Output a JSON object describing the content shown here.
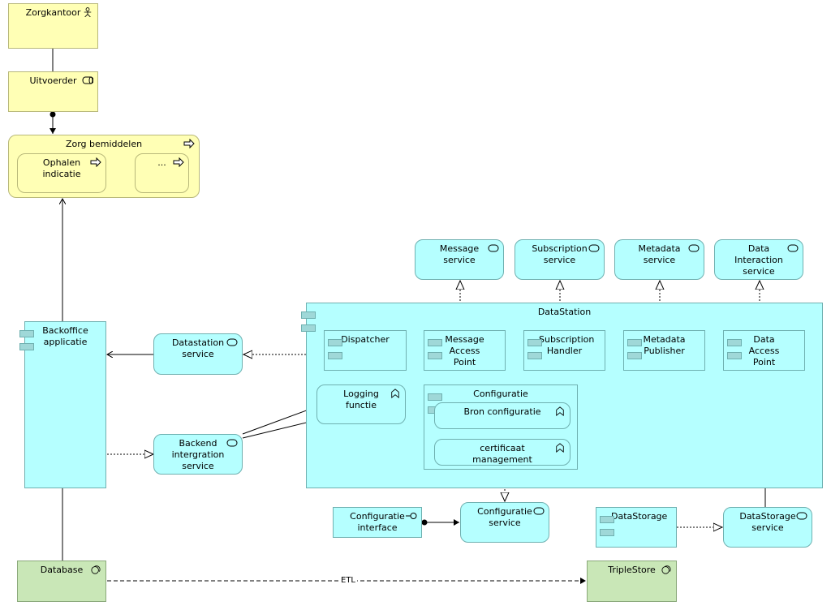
{
  "colors": {
    "business": "#ffffb5",
    "application": "#b5ffff",
    "technology": "#c9e7b7"
  },
  "elements": {
    "zorgkantoor": {
      "label": "Zorgkantoor",
      "icon": "actor-icon"
    },
    "uitvoerder": {
      "label": "Uitvoerder",
      "icon": "role-icon"
    },
    "zorg_bemiddelen": {
      "label": "Zorg bemiddelen",
      "icon": "process-icon"
    },
    "ophalen_indicatie": {
      "label": "Ophalen indicatie",
      "icon": "process-icon"
    },
    "ellipsis": {
      "label": "...",
      "icon": "process-icon"
    },
    "backoffice": {
      "label": "Backoffice applicatie",
      "icon": "component-icon"
    },
    "datastation_service": {
      "label": "Datastation service",
      "icon": "service-icon"
    },
    "backend_service": {
      "label": "Backend intergration service",
      "icon": "service-icon"
    },
    "message_service": {
      "label": "Message service",
      "icon": "service-icon"
    },
    "subscription_service": {
      "label": "Subscription service",
      "icon": "service-icon"
    },
    "metadata_service": {
      "label": "Metadata service",
      "icon": "service-icon"
    },
    "data_interaction_service": {
      "label": "Data Interaction service",
      "icon": "service-icon"
    },
    "datastation": {
      "label": "DataStation",
      "icon": "component-icon"
    },
    "dispatcher": {
      "label": "Dispatcher"
    },
    "message_access_point": {
      "label": "Message Access Point"
    },
    "subscription_handler": {
      "label": "Subscription Handler"
    },
    "metadata_publisher": {
      "label": "Metadata Publisher"
    },
    "data_access_point": {
      "label": "Data Access Point"
    },
    "logging_functie": {
      "label": "Logging functie",
      "icon": "function-icon"
    },
    "configuratie": {
      "label": "Configuratie"
    },
    "bron_configuratie": {
      "label": "Bron configuratie",
      "icon": "function-icon"
    },
    "certificaat_management": {
      "label": "certificaat management",
      "icon": "function-icon"
    },
    "configuratie_interface": {
      "label": "Configuratie interface",
      "icon": "interface-icon"
    },
    "configuratie_service": {
      "label": "Configuratie service",
      "icon": "service-icon"
    },
    "datastorage": {
      "label": "DataStorage"
    },
    "datastorage_service": {
      "label": "DataStorage service",
      "icon": "service-icon"
    },
    "database": {
      "label": "Database",
      "icon": "system-software-icon"
    },
    "triplestore": {
      "label": "TripleStore",
      "icon": "system-software-icon"
    }
  },
  "edges": {
    "etl_label": "ETL"
  }
}
